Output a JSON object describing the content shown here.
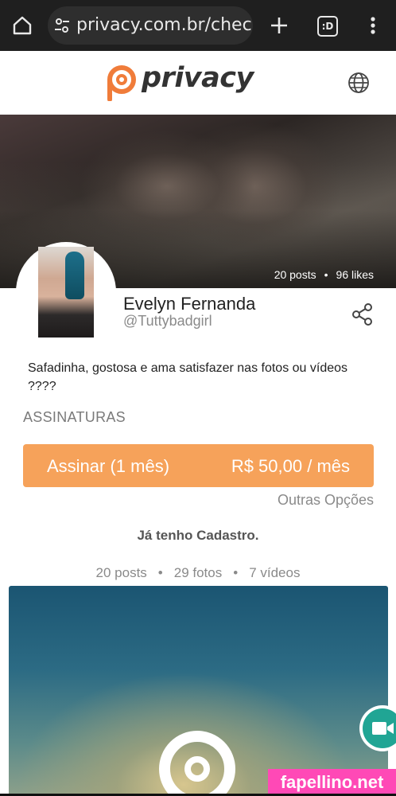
{
  "browser": {
    "url_display": "privacy.com.br/checko",
    "tabs_label": ":D"
  },
  "header": {
    "brand": "privacy"
  },
  "cover": {
    "posts": "20 posts",
    "separator": "•",
    "likes": "96 likes"
  },
  "profile": {
    "name": "Evelyn Fernanda",
    "handle": "@Tuttybadgirl",
    "bio": "Safadinha, gostosa e ama satisfazer nas fotos ou vídeos ????"
  },
  "subscriptions": {
    "title": "ASSINATURAS",
    "plan": "Assinar (1 mês)",
    "price": "R$ 50,00 / mês",
    "other_options": "Outras Opções"
  },
  "account": {
    "login_text": "Já tenho Cadastro."
  },
  "content_stats": {
    "posts": "20 posts",
    "separator": "•",
    "photos": "29 fotos",
    "videos": "7 vídeos"
  },
  "watermark": "fapellino.net",
  "colors": {
    "accent": "#f6a25a",
    "brand": "#f07c3a",
    "fab": "#20a594",
    "watermark_bg": "#ff49b6"
  },
  "icons": [
    "home-icon",
    "tune-icon",
    "plus-icon",
    "menu-icon",
    "globe-icon",
    "share-icon",
    "video-camera-icon"
  ]
}
